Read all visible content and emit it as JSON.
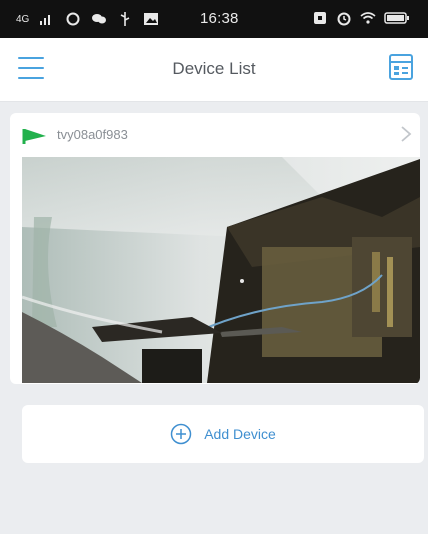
{
  "status_bar": {
    "network": "4G",
    "time": "16:38",
    "icons_left": [
      "signal-icon",
      "ring-icon",
      "chat-icon",
      "usb-icon",
      "image-icon"
    ],
    "icons_right": [
      "nfc-icon",
      "alarm-icon",
      "wifi-icon",
      "battery-icon"
    ]
  },
  "header": {
    "title": "Device List",
    "left_icon": "menu-icon",
    "right_icon": "grid-layout-icon"
  },
  "device": {
    "name": "tvy08a0f983",
    "status_icon": "online-flag-icon",
    "preview_alt": "camera-preview"
  },
  "add_device": {
    "label": "Add Device",
    "icon": "plus-circle-icon"
  },
  "colors": {
    "accent": "#3f8fd0",
    "online": "#22b14c",
    "background": "#ebedf0"
  }
}
